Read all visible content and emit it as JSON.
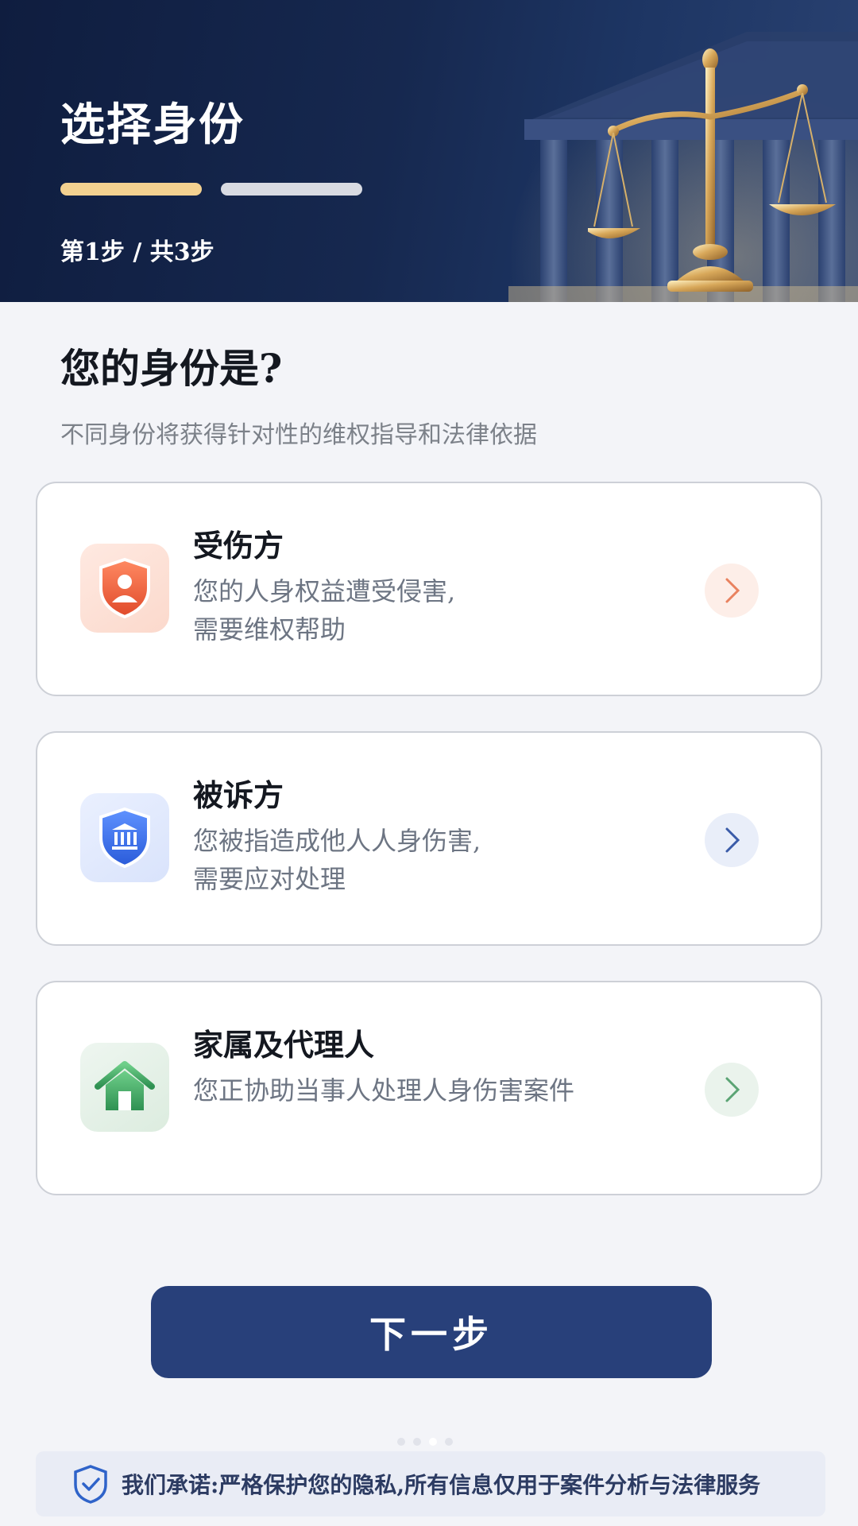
{
  "header": {
    "title": "选择身份",
    "step_text": "第1步 / 共3步",
    "progress": {
      "current_step": 1,
      "segments_shown": 2
    }
  },
  "question": {
    "title": "您的身份是?",
    "subtitle": "不同身份将获得针对性的维权指导和法律依据"
  },
  "options": [
    {
      "title": "受伤方",
      "desc_line1": "您的人身权益遭受侵害,",
      "desc_line2": "需要维权帮助",
      "icon": "person-shield-icon",
      "accent": "#ef6a45"
    },
    {
      "title": "被诉方",
      "desc_line1": "您被指造成他人人身伤害,",
      "desc_line2": "需要应对处理",
      "icon": "courthouse-shield-icon",
      "accent": "#3f74e8"
    },
    {
      "title": "家属及代理人",
      "desc_line1": "您正协助当事人处理人身伤害案件",
      "desc_line2": "",
      "icon": "house-icon",
      "accent": "#4cab6c"
    }
  ],
  "next_button": {
    "label": "下一步"
  },
  "privacy": {
    "text": "我们承诺:严格保护您的隐私,所有信息仅用于案件分析与法律服务"
  },
  "colors": {
    "header_bg": "#16284f",
    "progress_active": "#f3d190",
    "primary_button": "#28407a"
  }
}
